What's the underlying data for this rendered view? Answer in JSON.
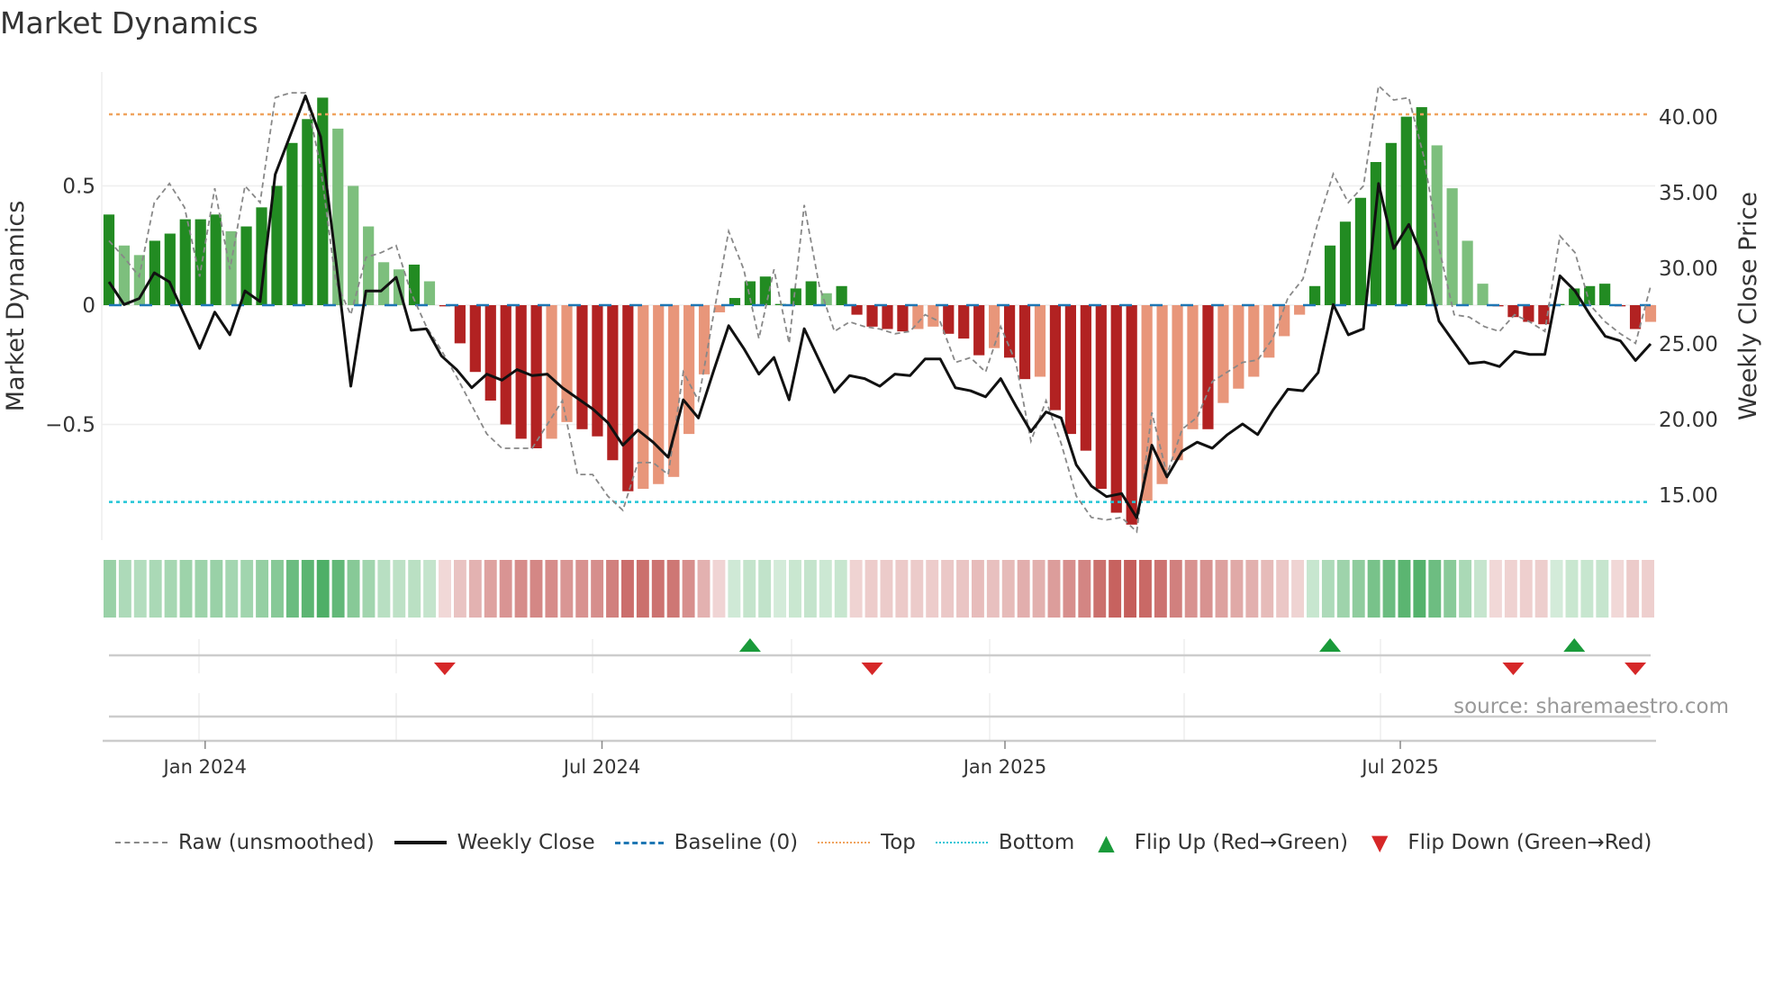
{
  "title": "Market Dynamics",
  "source": "source: sharemaestro.com",
  "legend": {
    "raw": "Raw (unsmoothed)",
    "close": "Weekly Close",
    "baseline": "Baseline (0)",
    "top": "Top",
    "bottom": "Bottom",
    "flip_up": "Flip Up (Red→Green)",
    "flip_down": "Flip Down (Green→Red)"
  },
  "colors": {
    "green_dark": "#228b22",
    "green_light": "#7dbf7d",
    "red_dark": "#b22222",
    "red_light": "#e8967a",
    "raw": "#888888",
    "close": "#111111",
    "baseline": "#1f77b4",
    "top": "#f0a35e",
    "bottom": "#22c5d6",
    "flip_up": "#1a9a3a",
    "flip_down": "#d62728"
  },
  "chart_data": {
    "type": "bar",
    "title": "Market Dynamics",
    "ylabel": "Market Dynamics",
    "y2label": "Weekly Close Price",
    "ylim": [
      -1.0,
      1.0
    ],
    "y_ticks": [
      {
        "v": 0.5,
        "label": "0.5"
      },
      {
        "v": 0,
        "label": "0"
      },
      {
        "v": -0.5,
        "label": "−0.5"
      }
    ],
    "y2_ticks": [
      {
        "v": 40,
        "label": "40.00"
      },
      {
        "v": 35,
        "label": "35.00"
      },
      {
        "v": 30,
        "label": "30.00"
      },
      {
        "v": 25,
        "label": "25.00"
      },
      {
        "v": 20,
        "label": "20.00"
      },
      {
        "v": 15,
        "label": "15.00"
      }
    ],
    "x_ticks": [
      {
        "i": 6.3,
        "label": "Jan 2024"
      },
      {
        "i": 32.3,
        "label": "Jul 2024"
      },
      {
        "i": 58.7,
        "label": "Jan 2025"
      },
      {
        "i": 84.6,
        "label": "Jul 2025"
      }
    ],
    "top_level": 0.8,
    "bottom_level": -0.825,
    "baseline": 0,
    "bars": [
      0.38,
      0.25,
      0.21,
      0.27,
      0.3,
      0.36,
      0.36,
      0.38,
      0.31,
      0.33,
      0.41,
      0.5,
      0.68,
      0.78,
      0.87,
      0.74,
      0.5,
      0.33,
      0.18,
      0.15,
      0.17,
      0.1,
      -0.005,
      -0.16,
      -0.28,
      -0.4,
      -0.5,
      -0.56,
      -0.6,
      -0.56,
      -0.49,
      -0.52,
      -0.55,
      -0.65,
      -0.78,
      -0.77,
      -0.75,
      -0.72,
      -0.54,
      -0.29,
      -0.03,
      0.03,
      0.1,
      0.12,
      0.005,
      0.07,
      0.1,
      0.05,
      0.08,
      -0.04,
      -0.09,
      -0.1,
      -0.11,
      -0.1,
      -0.09,
      -0.12,
      -0.14,
      -0.21,
      -0.18,
      -0.22,
      -0.31,
      -0.3,
      -0.44,
      -0.54,
      -0.61,
      -0.77,
      -0.87,
      -0.92,
      -0.82,
      -0.75,
      -0.65,
      -0.52,
      -0.52,
      -0.41,
      -0.35,
      -0.3,
      -0.22,
      -0.13,
      -0.04,
      0.08,
      0.25,
      0.35,
      0.45,
      0.6,
      0.68,
      0.79,
      0.83,
      0.67,
      0.49,
      0.27,
      0.09,
      -0.005,
      -0.05,
      -0.07,
      -0.08,
      0.005,
      0.07,
      0.08,
      0.09,
      -0.005,
      -0.1,
      -0.07
    ],
    "bar_shade": [
      "d",
      "l",
      "l",
      "d",
      "d",
      "d",
      "d",
      "d",
      "l",
      "d",
      "d",
      "d",
      "d",
      "d",
      "d",
      "l",
      "l",
      "l",
      "l",
      "l",
      "d",
      "l",
      "d",
      "d",
      "d",
      "d",
      "d",
      "d",
      "d",
      "l",
      "l",
      "d",
      "d",
      "d",
      "d",
      "l",
      "l",
      "l",
      "l",
      "l",
      "l",
      "d",
      "d",
      "d",
      "d",
      "d",
      "d",
      "l",
      "d",
      "d",
      "d",
      "d",
      "d",
      "l",
      "l",
      "d",
      "d",
      "d",
      "l",
      "d",
      "d",
      "l",
      "d",
      "d",
      "d",
      "d",
      "d",
      "d",
      "l",
      "l",
      "l",
      "l",
      "d",
      "l",
      "l",
      "l",
      "l",
      "l",
      "l",
      "d",
      "d",
      "d",
      "d",
      "d",
      "d",
      "d",
      "d",
      "l",
      "l",
      "l",
      "l",
      "d",
      "d",
      "d",
      "d",
      "d",
      "d",
      "d",
      "d",
      "d",
      "d",
      "l"
    ],
    "raw": [
      0.27,
      0.2,
      0.12,
      0.43,
      0.51,
      0.41,
      0.12,
      0.49,
      0.15,
      0.5,
      0.43,
      0.87,
      0.89,
      0.89,
      0.58,
      0.1,
      -0.04,
      0.2,
      0.22,
      0.25,
      0.05,
      -0.09,
      -0.19,
      -0.3,
      -0.42,
      -0.54,
      -0.6,
      -0.6,
      -0.6,
      -0.5,
      -0.4,
      -0.71,
      -0.71,
      -0.8,
      -0.86,
      -0.66,
      -0.66,
      -0.71,
      -0.28,
      -0.4,
      -0.04,
      0.31,
      0.15,
      -0.14,
      0.15,
      -0.16,
      0.42,
      0.08,
      -0.11,
      -0.07,
      -0.09,
      -0.1,
      -0.12,
      -0.11,
      -0.04,
      -0.07,
      -0.24,
      -0.22,
      -0.28,
      -0.09,
      -0.24,
      -0.57,
      -0.4,
      -0.58,
      -0.8,
      -0.89,
      -0.9,
      -0.89,
      -0.95,
      -0.45,
      -0.71,
      -0.52,
      -0.47,
      -0.32,
      -0.28,
      -0.24,
      -0.23,
      -0.14,
      0.03,
      0.11,
      0.35,
      0.55,
      0.43,
      0.5,
      0.92,
      0.86,
      0.87,
      0.62,
      0.24,
      -0.04,
      -0.05,
      -0.09,
      -0.11,
      -0.04,
      -0.07,
      -0.11,
      0.29,
      0.22,
      0.0,
      -0.07,
      -0.12,
      -0.16,
      0.08
    ],
    "close": [
      29.1,
      27.6,
      28.0,
      29.7,
      29.1,
      26.9,
      24.7,
      27.1,
      25.6,
      28.5,
      27.8,
      36.2,
      38.8,
      41.4,
      38.7,
      30.6,
      22.2,
      28.5,
      28.5,
      29.4,
      25.9,
      26.0,
      24.2,
      23.3,
      22.1,
      23.0,
      22.6,
      23.3,
      22.9,
      23.0,
      22.1,
      21.4,
      20.7,
      19.8,
      18.3,
      19.3,
      18.5,
      17.5,
      21.3,
      20.1,
      23.2,
      26.2,
      24.7,
      23.0,
      24.1,
      21.3,
      26.0,
      23.9,
      21.8,
      22.9,
      22.7,
      22.2,
      23.0,
      22.9,
      24.0,
      24.0,
      22.1,
      21.9,
      21.5,
      22.7,
      20.9,
      19.2,
      20.5,
      20.1,
      17.0,
      15.6,
      14.9,
      15.1,
      13.5,
      18.3,
      16.2,
      17.9,
      18.5,
      18.1,
      19.0,
      19.7,
      19.0,
      20.6,
      22.0,
      21.9,
      23.1,
      27.6,
      25.6,
      26.0,
      35.6,
      31.3,
      32.9,
      30.5,
      26.5,
      25.1,
      23.7,
      23.8,
      23.5,
      24.5,
      24.3,
      24.3,
      29.5,
      28.5,
      26.9,
      25.5,
      25.2,
      23.9,
      25.0
    ],
    "flips_up": [
      42,
      80,
      96
    ],
    "flips_down": [
      22,
      50,
      92,
      100
    ]
  }
}
